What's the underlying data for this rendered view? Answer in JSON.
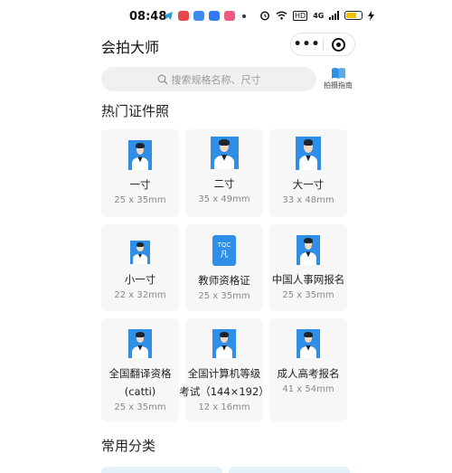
{
  "status": {
    "time": "08:48",
    "signal_text": "4G",
    "battery_level": 0.7
  },
  "nav": {
    "title": "会拍大师",
    "more_label": "•••"
  },
  "search": {
    "placeholder": "搜索规格名称、尺寸",
    "guide_label": "拍摄指南"
  },
  "sections": {
    "hot_title": "热门证件照",
    "common_title": "常用分类"
  },
  "cards": [
    {
      "name": "一寸",
      "size": "25 x 35mm",
      "icon": "portrait-photo-icon"
    },
    {
      "name": "二寸",
      "size": "35 x 49mm",
      "icon": "portrait-photo-icon"
    },
    {
      "name": "大一寸",
      "size": "33 x 48mm",
      "icon": "portrait-photo-icon"
    },
    {
      "name": "小一寸",
      "size": "22 x 32mm",
      "icon": "portrait-photo-icon"
    },
    {
      "name": "教师资格证",
      "size": "25 x 35mm",
      "icon": "certificate-icon",
      "icon_text_1": "TQC",
      "icon_text_2": "凡"
    },
    {
      "name": "中国人事网报名",
      "size": "25 x 35mm",
      "icon": "portrait-photo-icon"
    },
    {
      "name": "全国翻译资格",
      "name_line2": "(catti)",
      "size": "25 x 35mm",
      "icon": "portrait-photo-icon"
    },
    {
      "name": "全国计算机等级",
      "name_line2": "考试（144×192）",
      "size": "12 x 16mm",
      "icon": "portrait-photo-icon"
    },
    {
      "name": "成人高考报名",
      "size": "41 x 54mm",
      "icon": "portrait-photo-icon"
    }
  ],
  "colors": {
    "accent_blue": "#2f8fe6",
    "card_bg": "#f7f7f7",
    "search_bg": "#f0f0f0"
  }
}
